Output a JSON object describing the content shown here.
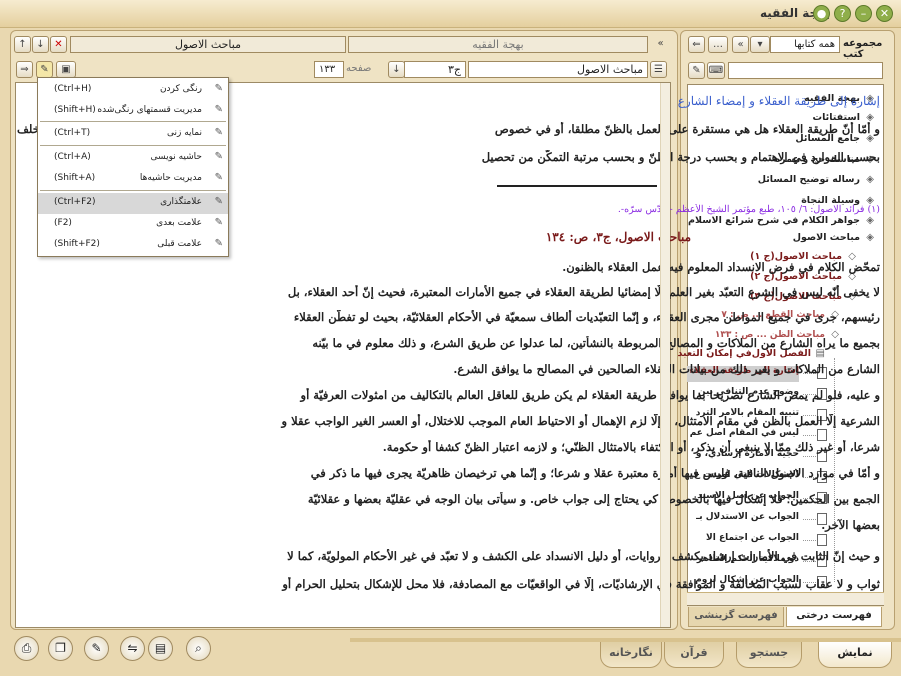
{
  "app": {
    "title": "بهجة الفقيه"
  },
  "library": {
    "heading": "مجموعه کتب",
    "dropdown": "همه کتابها"
  },
  "doc": {
    "title": "مباحث الاصول",
    "top_tab": "بهجة الفقيه",
    "vol": "ج۳",
    "page_label": "صفحه",
    "page": "۱۳۳",
    "path": "مباحث الاصول",
    "heading": "إشارة إلى طريقة العقلاء و إمضاء الشارع",
    "lines_a": [
      "و أمّا أنّ طريقة العقلاء هل هي مستقرة على العمل بالظنّ مطلقا، أو في خصوص",
      "بحسب الموارد في الاهتمام و بحسب درجة الظنّ و بحسب مرتبة التمكّن من تحصيل"
    ],
    "overflow_word": "خلف",
    "footnote": "(١) فرائد الاصول: ٦/ ١٠٥، طبع مؤتمر الشيخ الأعظم - قدّس سرّه-.",
    "ref": "مباحث الاصول، ج٣، ص: ١٣٤",
    "lines_b": [
      "تمحّض الكلام في فرض الانسداد المعلوم فيه عمل العقلاء بالظنون.",
      "لا يخفى أنّه ليس في الشرع التعبّد بغير العلم إلّا إمضائيا لطريقة العقلاء في جميع الأمارات المعتبرة، فحيث إنّ أحد العقلاء، بل",
      "رئيسهم، جرى في جميع المواطن مجرى العقلاء، و إنّما التعبّديات ألطاف سمعيّة في الأحكام العقلائيّة، بحيث لو تفطّن العقلاء",
      "بجميع ما يراه الشارع من الملاكات و المصالح المربوطة بالنشأتين، لما عدلوا عن طريق الشرع، و ذلك معلوم في ما بيّنه",
      "الشارع من الملاكات و بغير ذلك من بيانات العقلاء الصالحين في المصالح ما يوافق الشرع.",
      "و عليه، فلو لم يمض الشارع تصريحا بما يوافق طريقة العقلاء لم يكن طريق للعاقل العالم بالتكاليف من امثولات العرفيّة أو",
      "الشرعية إلّا العمل بالظن في مقام الامتثال، و إلّا لزم الإهمال أو الاحتياط العام الموجب للاختلال، أو العسر الغير الواجب عقلا و",
      "شرعا، أو غير ذلك ممّا لا ينبغي أن يذكر، أو الاكتفاء بالامتثال الظنّي؛ و لازمه اعتبار الظنّ كشفا أو حكومة.",
      "و أمّا في موارد الاصول النافية، فليس فيها أمارة معتبرة عقلا و شرعا؛ و إنّما هي ترخيصان ظاهريّة يجرى فيها ما ذكر في",
      "الجمع بين الحكمين؛ فلا إشكال فيها بالخصوص كي يحتاج إلى جواب خاص. و سيأتى بيان الوجه في عقليّة بعضها و عقلائيّة",
      "بعضها الآخر.",
      "و حيث إنّ الثابت في الأمارات إرشاد بكشف الروايات، أو دليل الانسداد على الكشف و لا تعبّد في غير الأحكام المولويّة، كما لا",
      "ثواب و لا عقاب لسبب المخالفة و الموافقة في الإرشاديّات، إلّا في الواقعيّات مع المصادفة، فلا محل للإشكال بتحليل الحرام أو"
    ]
  },
  "menu": [
    {
      "label": "رنگی کردن",
      "shortcut": "(Ctrl+H)"
    },
    {
      "label": "مدیریت قسمتهای رنگی‌شده",
      "shortcut": "(Shift+H)"
    },
    {
      "label": "نمایه زنی",
      "shortcut": "(Ctrl+T)"
    },
    {
      "label": "حاشیه نویسی",
      "shortcut": "(Ctrl+A)"
    },
    {
      "label": "مدیریت حاشیه‌ها",
      "shortcut": "(Shift+A)"
    },
    {
      "label": "علامتگذاری",
      "shortcut": "(Ctrl+F2)"
    },
    {
      "label": "علامت بعدی",
      "shortcut": "(F2)"
    },
    {
      "label": "علامت قبلی",
      "shortcut": "(Shift+F2)"
    }
  ],
  "tree": [
    "بهجة الفقيه",
    "استفتائات",
    "جامع المسائل",
    "مناسك حج و عمره",
    "رساله توضيح المسائل",
    "وسيلة النجاة",
    "جواهر الكلام في شرح شرائع الاسلام",
    "مباحث الاصول"
  ],
  "tree_sub": [
    "مباحث الاصول(ج ١)",
    "مباحث الاصول(ج ٢)",
    "مباحث الاصول(ج ٣)"
  ],
  "tree_sub2": [
    {
      "label": "مباحث القطع ... ص : ٧"
    },
    {
      "label": "مباحث الظن ... ص : ١٣٣"
    }
  ],
  "tree_chapter": "الفصل الأول‌في إمكان التعبد",
  "tree_leaves": [
    "إشارة إلى طريقة العقلاء",
    "وضوح عدم التنافي بين",
    "تنبيه المقام بالأمر الترد",
    "ليس في المقام أصل عم",
    "حجية الأمارة إرشادي، و",
    "الإشكالات التي اوردت ع",
    "الجواب عن أصل الاسند",
    "الجواب عن الاستدلال بـ",
    "الجواب عن اجتماع الا",
    "ذو ملاكية الحكم الظاهر",
    "الجواب عن إشكال لزوم"
  ],
  "left_tabs": {
    "tree": "فهرست درختی",
    "search": "فهرست گزينشی"
  },
  "bottom_tabs": [
    "نمايش",
    "جستجو",
    "قرآن",
    "نگارخانه"
  ],
  "colors": {
    "accent": "#7a1a1a",
    "heading_blue": "#3a5fcd",
    "footnote_purple": "#8a2be2",
    "highlight": "#cfcfcf"
  }
}
